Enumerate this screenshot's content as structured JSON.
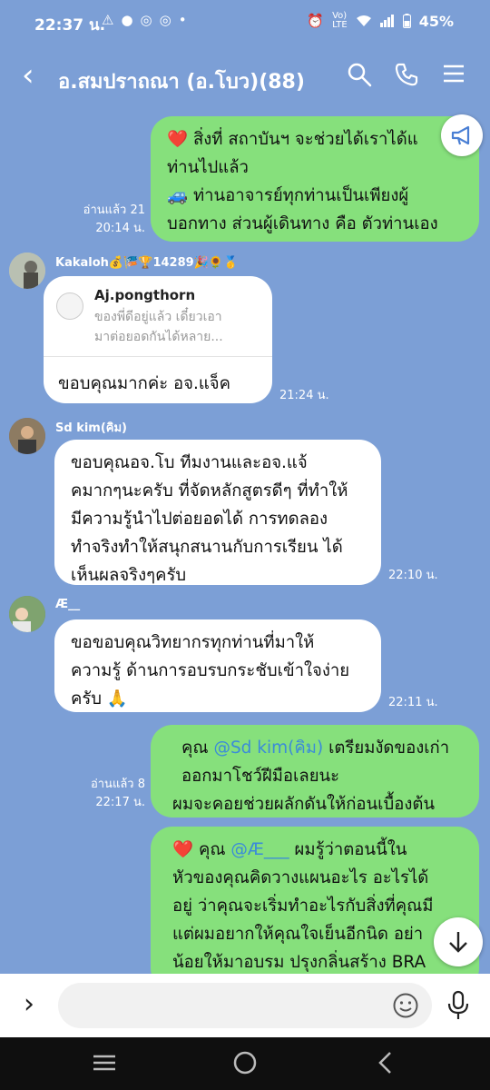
{
  "status_bar": {
    "time": "22:37 น.",
    "battery": "45%"
  },
  "header": {
    "title": "อ.สมปราถณา (อ.โบว)(88)"
  },
  "messages": {
    "m1": {
      "lines": [
        "สิ่งที่ สถาบันฯ จะช่วยได้เราได้แ",
        "ท่านไปแล้ว",
        "ท่านอาจารย์ทุกท่านเป็นเพียงผู้",
        "บอกทาง ส่วนผู้เดินทาง คือ ตัวท่านเอง"
      ],
      "read": "อ่านแล้ว 21",
      "time": "20:14 น."
    },
    "m2": {
      "sender": "Kakaloh💰🎏🏆14289🎉🌻🥇",
      "reply_name": "Aj.pongthorn",
      "reply_lines": [
        "ของพี่ดีอยู่แล้ว เดี๋ยวเอา",
        "มาต่อยอดกันได้หลาย..."
      ],
      "text": "ขอบคุณมากค่ะ อจ.แจ็ค",
      "time": "21:24 น."
    },
    "m3": {
      "sender": "Sd kim(คิม)",
      "lines": [
        "ขอบคุณอจ.โบ ทีมงานและอจ.แจ้",
        "คมากๆนะครับ ที่จัดหลักสูตรดีๆ ที่ทำให้",
        "มีความรู้นำไปต่อยอดได้ การทดลอง",
        "ทำจริงทำให้สนุกสนานกับการเรียน ได้",
        "เห็นผลจริงๆครับ"
      ],
      "time": "22:10 น."
    },
    "m4": {
      "sender": "Æ__",
      "lines": [
        "ขอขอบคุณวิทยากรทุกท่านที่มาให้",
        "ความรู้ ด้านการอบรบกระชับเข้าใจง่าย",
        "ครับ 🙏"
      ],
      "time": "22:11 น."
    },
    "m5": {
      "prefix": "คุณ",
      "mention": "@Sd kim(คิม)",
      "suffix": "เตรียมงัดของเก่า",
      "lines": [
        "ออกมาโชว์ฝีมือเลยนะ",
        "ผมจะคอยช่วยผลักดันให้ก่อนเบื้องต้น"
      ],
      "read": "อ่านแล้ว 8",
      "time": "22:17 น."
    },
    "m6": {
      "prefix": "คุณ",
      "mention": "@Æ___",
      "suffix": "ผมรู้ว่าตอนนี้ใน",
      "lines": [
        "หัวของคุณคิดวางแผนอะไร อะไรได้",
        "อยู่ ว่าคุณจะเริ่มทำอะไรกับสิ่งที่คุณมี",
        "แต่ผมอยากให้คุณใจเย็นอีกนิด อย่า",
        "น้อยให้มาอบรม ปรุงกลิ่นสร้าง BRA"
      ]
    }
  },
  "input": {
    "placeholder": ""
  },
  "icons": {
    "back": "back-arrow-icon",
    "search": "search-icon",
    "call": "phone-icon",
    "menu": "menu-icon",
    "announce": "megaphone-icon",
    "scroll": "arrow-down-icon",
    "emoji": "emoji-icon",
    "mic": "microphone-icon",
    "expand": "chevron-right-icon"
  },
  "colors": {
    "background": "#7c9fd6",
    "outgoing_bubble": "#86e07c",
    "incoming_bubble": "#ffffff",
    "mention": "#3b8bd9"
  }
}
